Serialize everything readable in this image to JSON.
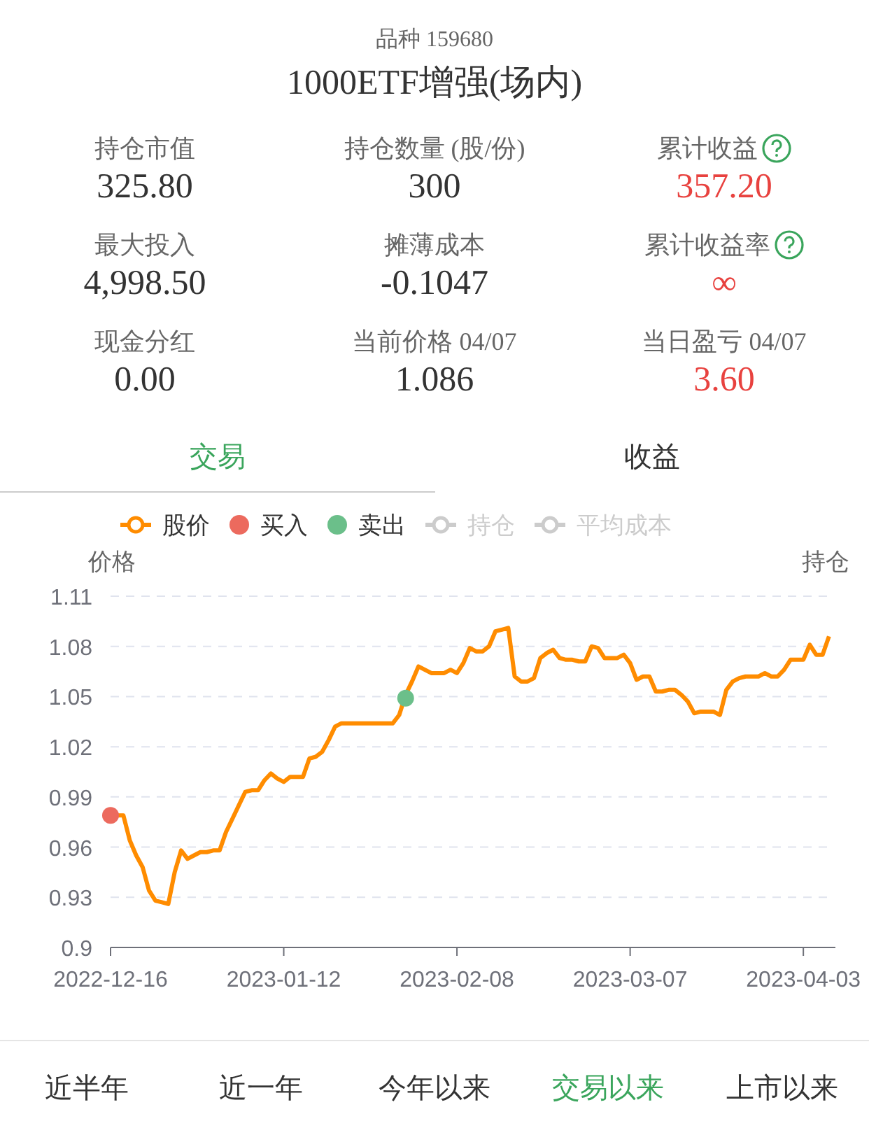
{
  "header": {
    "code_label": "品种 159680",
    "title": "1000ETF增强(场内)"
  },
  "stats": [
    {
      "label": "持仓市值",
      "value": "325.80",
      "color": "#333333",
      "help": false
    },
    {
      "label": "持仓数量 (股/份)",
      "value": "300",
      "color": "#333333",
      "help": false
    },
    {
      "label": "累计收益",
      "value": "357.20",
      "color": "#e8423f",
      "help": true
    },
    {
      "label": "最大投入",
      "value": "4,998.50",
      "color": "#333333",
      "help": false
    },
    {
      "label": "摊薄成本",
      "value": "-0.1047",
      "color": "#333333",
      "help": false
    },
    {
      "label": "累计收益率",
      "value": "∞",
      "color": "#e8423f",
      "help": true
    },
    {
      "label": "现金分红",
      "value": "0.00",
      "color": "#333333",
      "help": false
    },
    {
      "label": "当前价格 04/07",
      "value": "1.086",
      "color": "#333333",
      "help": false
    },
    {
      "label": "当日盈亏 04/07",
      "value": "3.60",
      "color": "#e8423f",
      "help": false
    }
  ],
  "tabs": [
    {
      "label": "交易",
      "selected": true
    },
    {
      "label": "收益",
      "selected": false
    }
  ],
  "legend_extra": [
    {
      "label": "持仓",
      "selected": false
    },
    {
      "label": "平均成本",
      "selected": false
    }
  ],
  "chart": {
    "left_axis_title": "价格",
    "right_axis_title": "持仓",
    "chart_data": {
      "type": "line",
      "grid": true,
      "legend": "top",
      "categories": [
        "2022-12-16",
        null,
        null,
        null,
        null,
        null,
        null,
        null,
        null,
        null,
        null,
        null,
        null,
        null,
        null,
        null,
        null,
        null,
        null,
        null,
        null,
        null,
        null,
        null,
        null,
        null,
        null,
        "2023-01-12",
        null,
        null,
        null,
        null,
        null,
        null,
        null,
        null,
        null,
        null,
        null,
        null,
        null,
        null,
        null,
        null,
        null,
        null,
        null,
        null,
        null,
        null,
        null,
        null,
        null,
        null,
        "2023-02-08",
        null,
        null,
        null,
        null,
        null,
        null,
        null,
        null,
        null,
        null,
        null,
        null,
        null,
        null,
        null,
        null,
        null,
        null,
        null,
        null,
        null,
        null,
        null,
        null,
        null,
        null,
        "2023-03-07",
        null,
        null,
        null,
        null,
        null,
        null,
        null,
        null,
        null,
        null,
        null,
        null,
        null,
        null,
        null,
        null,
        null,
        null,
        null,
        null,
        null,
        null,
        null,
        null,
        null,
        null,
        "2023-04-03",
        null,
        null,
        null,
        null
      ],
      "series": [
        {
          "name": "股价",
          "color": "#ff8c00",
          "values": [
            0.979,
            0.979,
            0.979,
            0.964,
            0.955,
            0.948,
            0.934,
            0.928,
            0.927,
            0.926,
            0.945,
            0.958,
            0.953,
            0.955,
            0.957,
            0.957,
            0.958,
            0.958,
            0.969,
            0.977,
            0.985,
            0.993,
            0.994,
            0.994,
            1.0,
            1.004,
            1.001,
            0.999,
            1.002,
            1.002,
            1.002,
            1.013,
            1.014,
            1.017,
            1.024,
            1.032,
            1.034,
            1.034,
            1.034,
            1.034,
            1.034,
            1.034,
            1.034,
            1.034,
            1.034,
            1.039,
            1.051,
            1.059,
            1.068,
            1.066,
            1.064,
            1.064,
            1.064,
            1.066,
            1.064,
            1.07,
            1.079,
            1.077,
            1.077,
            1.08,
            1.089,
            1.09,
            1.091,
            1.062,
            1.059,
            1.059,
            1.061,
            1.073,
            1.076,
            1.078,
            1.073,
            1.072,
            1.072,
            1.071,
            1.071,
            1.08,
            1.079,
            1.073,
            1.073,
            1.073,
            1.075,
            1.07,
            1.06,
            1.062,
            1.062,
            1.053,
            1.053,
            1.054,
            1.054,
            1.051,
            1.047,
            1.04,
            1.041,
            1.041,
            1.041,
            1.039,
            1.054,
            1.059,
            1.061,
            1.062,
            1.062,
            1.062,
            1.064,
            1.062,
            1.062,
            1.066,
            1.072,
            1.072,
            1.072,
            1.081,
            1.075,
            1.075,
            1.086
          ]
        },
        {
          "name": "买入",
          "color": "#ec6a5e",
          "marker": "circle",
          "values": [
            0.979,
            null,
            null,
            null,
            null,
            null,
            null,
            null,
            null,
            null,
            null,
            null,
            null,
            null,
            null,
            null,
            null,
            null,
            null,
            null,
            null,
            null,
            null,
            null,
            null,
            null,
            null,
            null,
            null,
            null,
            null,
            null,
            null,
            null,
            null,
            null,
            null,
            null,
            null,
            null,
            null,
            null,
            null,
            null,
            null,
            null,
            null,
            null,
            null,
            null,
            null,
            null,
            null,
            null,
            null,
            null,
            null,
            null,
            null,
            null,
            null,
            null,
            null,
            null,
            null,
            null,
            null,
            null,
            null,
            null,
            null,
            null,
            null,
            null,
            null,
            null,
            null,
            null,
            null,
            null,
            null,
            null,
            null,
            null,
            null,
            null,
            null,
            null,
            null,
            null,
            null,
            null,
            null,
            null,
            null,
            null,
            null,
            null,
            null,
            null,
            null,
            null,
            null,
            null,
            null,
            null,
            null,
            null,
            null,
            null,
            null,
            null,
            null
          ]
        },
        {
          "name": "卖出",
          "color": "#6bbf8a",
          "marker": "circle",
          "values": [
            null,
            null,
            null,
            null,
            null,
            null,
            null,
            null,
            null,
            null,
            null,
            null,
            null,
            null,
            null,
            null,
            null,
            null,
            null,
            null,
            null,
            null,
            null,
            null,
            null,
            null,
            null,
            null,
            null,
            null,
            null,
            null,
            null,
            null,
            null,
            null,
            null,
            null,
            null,
            null,
            null,
            null,
            null,
            null,
            null,
            null,
            1.049,
            null,
            null,
            null,
            null,
            null,
            null,
            null,
            null,
            null,
            null,
            null,
            null,
            null,
            null,
            null,
            null,
            null,
            null,
            null,
            null,
            null,
            null,
            null,
            null,
            null,
            null,
            null,
            null,
            null,
            null,
            null,
            null,
            null,
            null,
            null,
            null,
            null,
            null,
            null,
            null,
            null,
            null,
            null,
            null,
            null,
            null,
            null,
            null,
            null,
            null,
            null,
            null,
            null,
            null,
            null,
            null,
            null,
            null,
            null,
            null,
            null,
            null,
            null,
            null,
            null,
            null
          ]
        }
      ],
      "ylim": [
        0.9,
        1.11
      ],
      "yticks": [
        {
          "value": 0.9,
          "label": "0.9"
        },
        {
          "value": 0.93,
          "label": "0.93"
        },
        {
          "value": 0.96,
          "label": "0.96"
        },
        {
          "value": 0.99,
          "label": "0.99"
        },
        {
          "value": 1.02,
          "label": "1.02"
        },
        {
          "value": 1.05,
          "label": "1.05"
        },
        {
          "value": 1.08,
          "label": "1.08"
        },
        {
          "value": 1.11,
          "label": "1.11"
        }
      ]
    }
  },
  "ranges": [
    {
      "label": "近半年",
      "selected": false
    },
    {
      "label": "近一年",
      "selected": false
    },
    {
      "label": "今年以来",
      "selected": false
    },
    {
      "label": "交易以来",
      "selected": true
    },
    {
      "label": "上市以来",
      "selected": false
    }
  ]
}
